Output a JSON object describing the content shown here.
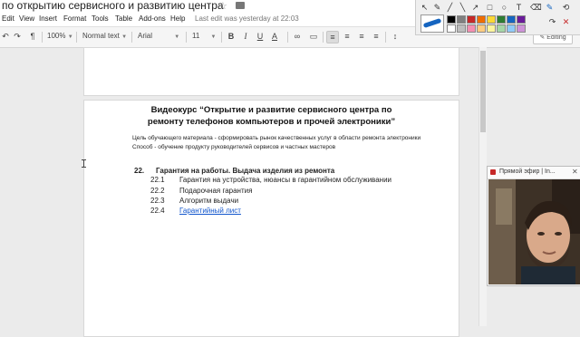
{
  "doc_title": "по открытию сервисного и развитию центра",
  "menu": [
    "Edit",
    "View",
    "Insert",
    "Format",
    "Tools",
    "Table",
    "Add-ons",
    "Help"
  ],
  "last_edit": "Last edit was yesterday at 22:03",
  "toolbar": {
    "zoom": "100%",
    "style": "Normal text",
    "font": "Arial",
    "size": "11",
    "bold": "B",
    "italic": "I",
    "underline": "U",
    "text_color": "A",
    "mode": "Editing"
  },
  "document": {
    "heading_line1": "Видеокурс “Открытие и развитие сервисного центра по",
    "heading_line2": "ремонту телефонов компьютеров и прочей электроники”",
    "goal": "Цель обучающего материала - сформировать рынок качественных услуг в области ремонта электроники",
    "method": "Способ - обучение продукту руководителей сервисов и частных мастеров",
    "section": {
      "number": "22.",
      "title": "Гарантия на работы. Выдача изделия из ремонта",
      "items": [
        {
          "number": "22.1",
          "text": "Гарантия на устройства, нюансы в гарантийном обслуживании"
        },
        {
          "number": "22.2",
          "text": "Подарочная гарантия"
        },
        {
          "number": "22.3",
          "text": "Алгоритм выдачи"
        },
        {
          "number": "22.4",
          "text": "Гарантийный лист"
        }
      ]
    }
  },
  "webcam_window": {
    "title": "Прямой эфир | In..."
  },
  "colors": {
    "link": "#1155cc",
    "pen": "#1565c0",
    "palette": [
      "#000000",
      "#7f7f7f",
      "#c62828",
      "#ef6c00",
      "#fdd835",
      "#2e7d32",
      "#1565c0",
      "#6a1b9a",
      "#ffffff",
      "#bdbdbd",
      "#f48fb1",
      "#ffcc80",
      "#fff59d",
      "#a5d6a7",
      "#90caf9",
      "#ce93d8"
    ]
  },
  "icons": [
    "undo-icon",
    "redo-icon",
    "print-icon",
    "paint-format-icon",
    "link-icon",
    "comment-icon",
    "align-left-icon",
    "align-center-icon",
    "align-right-icon",
    "justify-icon",
    "line-spacing-icon",
    "pen-icon",
    "eraser-icon",
    "star-icon",
    "folder-icon",
    "close-icon"
  ]
}
